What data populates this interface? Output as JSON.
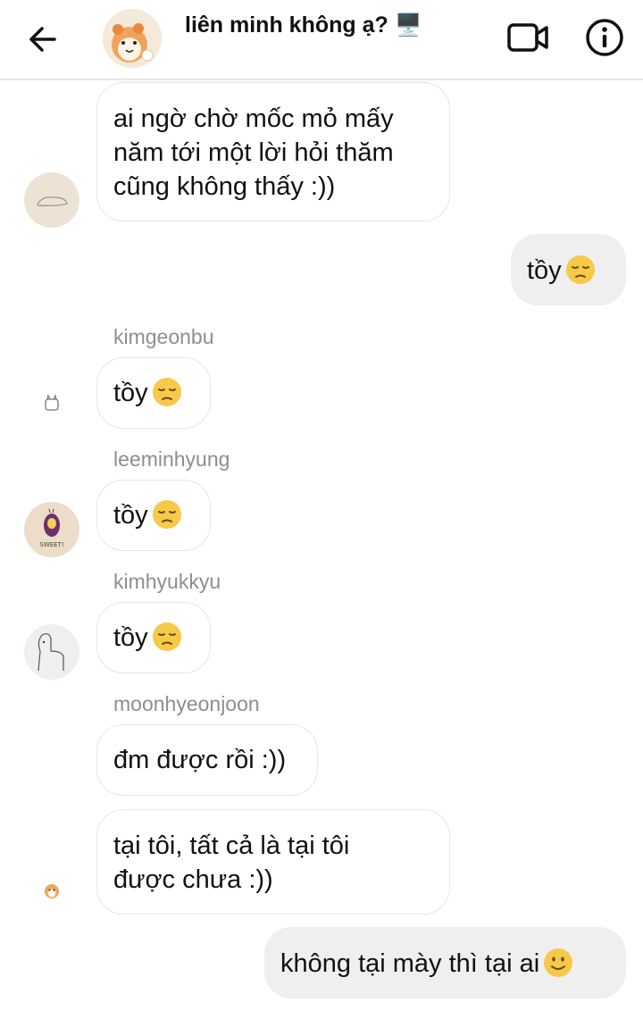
{
  "header": {
    "title": "liên minh không ạ? 🖥️",
    "back_icon": "arrow-left-icon",
    "video_icon": "video-camera-icon",
    "info_icon": "info-icon"
  },
  "messages": [
    {
      "id": "m1",
      "direction": "incoming",
      "sender": "",
      "lines": [
        "ai ngờ chờ mốc mỏ mấy",
        "năm tới một lời hỏi thăm",
        "cũng không thấy :))"
      ]
    },
    {
      "id": "m2",
      "direction": "outgoing",
      "text": "tồy",
      "emoji": "😔"
    },
    {
      "id": "m3",
      "direction": "incoming",
      "sender": "kimgeonbu",
      "text": "tồy",
      "emoji": "😔"
    },
    {
      "id": "m4",
      "direction": "incoming",
      "sender": "leeminhyung",
      "text": "tồy",
      "emoji": "😔"
    },
    {
      "id": "m5",
      "direction": "incoming",
      "sender": "kimhyukkyu",
      "text": "tồy",
      "emoji": "😔"
    },
    {
      "id": "m6",
      "direction": "incoming",
      "sender": "moonhyeonjoon",
      "text": "đm được rồi :))"
    },
    {
      "id": "m7",
      "direction": "incoming",
      "sender": "",
      "lines": [
        "tại tôi, tất cả là tại tôi",
        "được chưa :))"
      ]
    },
    {
      "id": "m8",
      "direction": "outgoing",
      "text": "không tại mày thì tại ai",
      "emoji": "🙂"
    }
  ],
  "avatar_labels": {
    "leeminhyung_avatar_text": "SWEET!"
  },
  "colors": {
    "incoming_bubble": "#ffffff",
    "outgoing_bubble": "#efefef",
    "sender_name": "#8e8e8e",
    "emoji_face": "#f7c948"
  }
}
